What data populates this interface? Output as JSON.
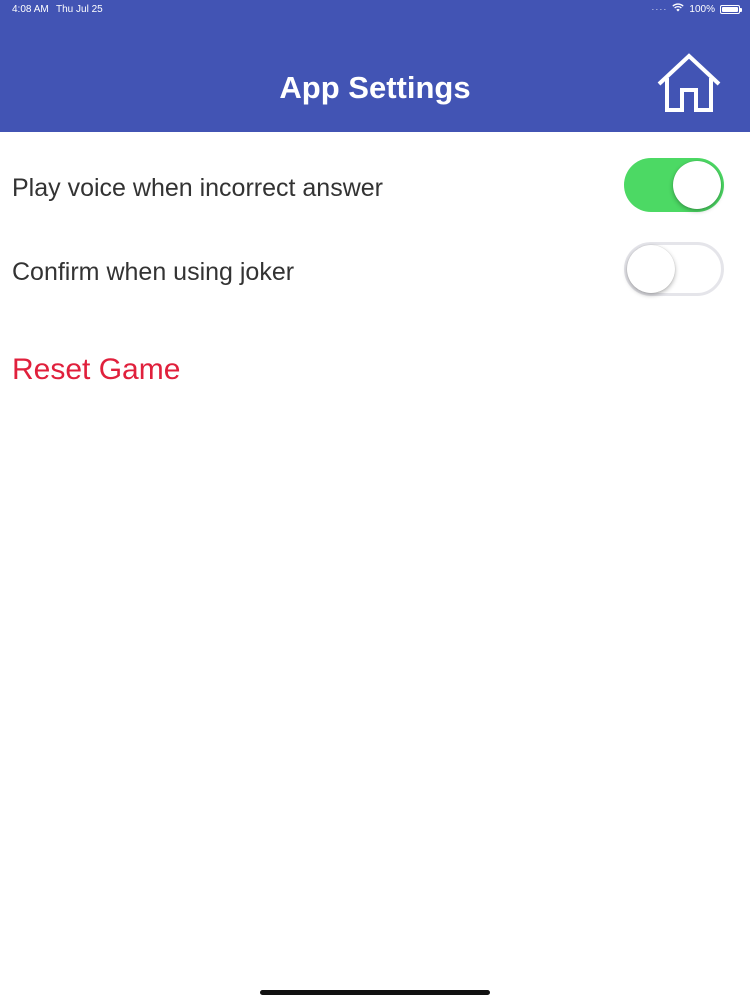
{
  "status_bar": {
    "time": "4:08 AM",
    "date": "Thu Jul 25",
    "battery": "100%",
    "wifi_icon": "wifi-icon",
    "battery_level": 1.0
  },
  "header": {
    "title": "App Settings",
    "home_icon": "home-icon",
    "background_color": "#4254b4"
  },
  "settings": [
    {
      "label": "Play voice when incorrect answer",
      "enabled": true
    },
    {
      "label": "Confirm when using joker",
      "enabled": false
    }
  ],
  "reset": {
    "label": "Reset Game",
    "color": "#e0203c"
  },
  "colors": {
    "toggle_on": "#4cd964",
    "toggle_off_border": "#e5e5ea"
  }
}
